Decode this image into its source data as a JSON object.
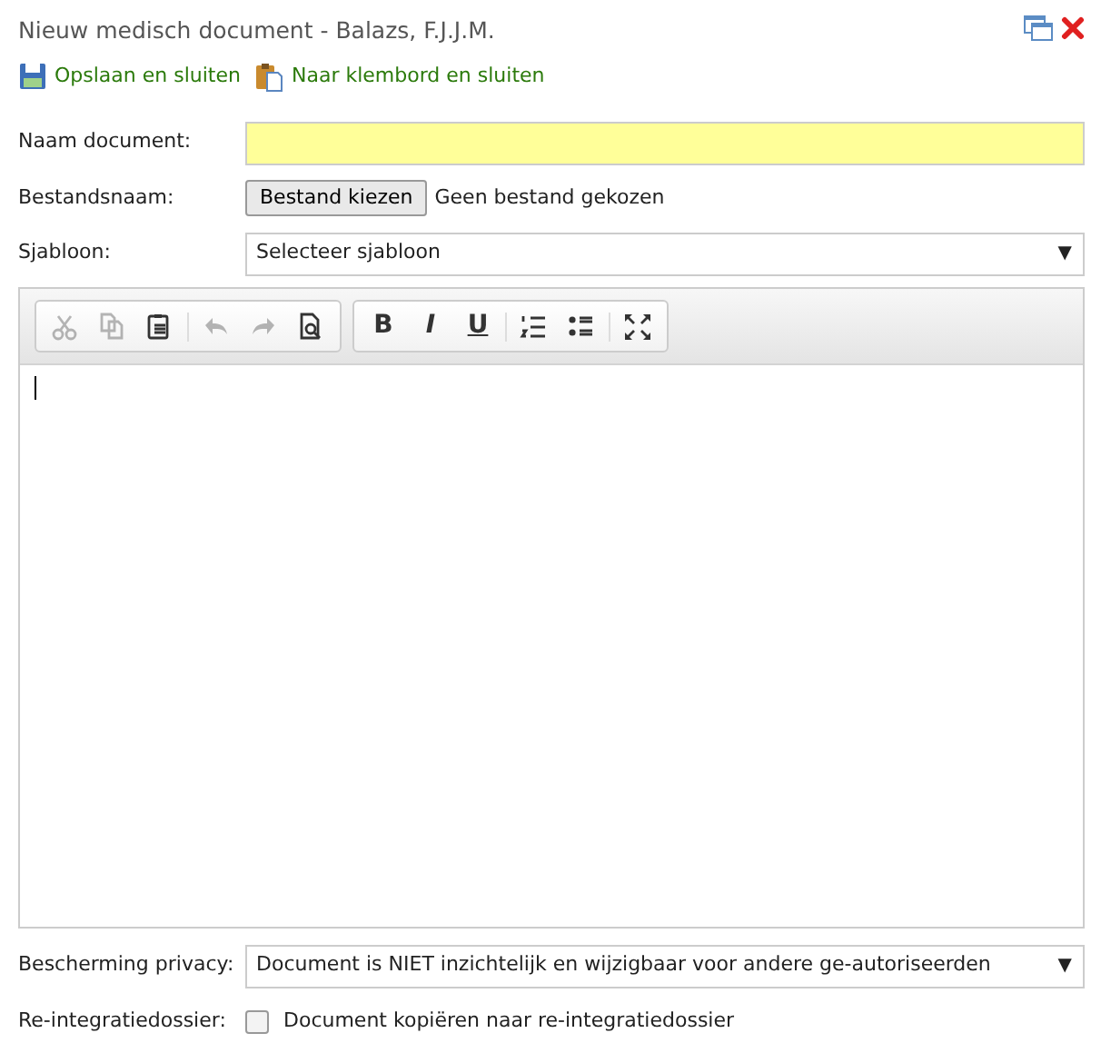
{
  "window": {
    "title": "Nieuw medisch document - Balazs, F.J.J.M."
  },
  "actions": [
    {
      "label": "Opslaan en sluiten",
      "kind": "save"
    },
    {
      "label": "Naar klembord en sluiten",
      "kind": "clipboard"
    }
  ],
  "name_field": {
    "label": "Naam document:"
  },
  "file_field": {
    "label": "Bestandsnaam:",
    "button": "Bestand kiezen",
    "status": "Geen bestand gekozen"
  },
  "template": {
    "label": "Sjabloon:",
    "value": "Selecteer sjabloon",
    "arrow": "▼"
  },
  "editor": {
    "toolbar": [
      [
        {
          "kind": "cut",
          "disabled": true
        },
        {
          "kind": "copy",
          "disabled": true
        },
        {
          "kind": "paste",
          "disabled": false
        },
        {
          "kind": "separator"
        },
        {
          "kind": "undo",
          "disabled": true
        },
        {
          "kind": "redo",
          "disabled": true
        },
        {
          "kind": "preview",
          "disabled": false
        }
      ],
      [
        {
          "kind": "bold",
          "text": "B",
          "disabled": false
        },
        {
          "kind": "italic",
          "text": "I",
          "disabled": false
        },
        {
          "kind": "underline",
          "text": "U",
          "disabled": false
        },
        {
          "kind": "separator"
        },
        {
          "kind": "numbered-list",
          "disabled": false
        },
        {
          "kind": "bullet-list",
          "disabled": false
        },
        {
          "kind": "separator"
        },
        {
          "kind": "maximize",
          "disabled": false
        }
      ]
    ]
  },
  "privacy": {
    "label": "Bescherming privacy:",
    "value": "Document is NIET inzichtelijk en wijzigbaar voor andere ge-autoriseerden",
    "arrow": "▼"
  },
  "reintegration": {
    "label": "Re-integratiedossier:",
    "checkbox_label": "Document kopiëren naar re-integratiedossier",
    "checked": false
  }
}
